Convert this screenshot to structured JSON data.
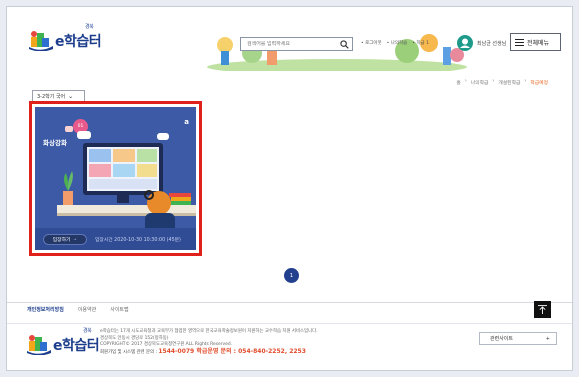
{
  "header": {
    "logo_text": "e학습터",
    "logo_small": "경북",
    "search_placeholder": "검색어를 입력하세요",
    "util_links": [
      "• 로그아웃",
      "• 나의학습",
      "• 학급 1"
    ],
    "user_name": "최남균 선생님",
    "menu_label": "전체메뉴"
  },
  "breadcrumb": [
    "홈",
    "›",
    "나의학급",
    "›",
    "개설된학급",
    "›",
    "학급예정"
  ],
  "filter": {
    "selected": "3-2학기 국어"
  },
  "card": {
    "title": "화상강화",
    "badge": "01",
    "corner_label": "a",
    "join_label": "입장하기",
    "join_arrow": "→",
    "join_time": "입장시간 2020-10-30 10:30:00 (45분)"
  },
  "pagination": {
    "current": "1"
  },
  "footer": {
    "links": [
      "개인정보처리방침",
      "이용약관",
      "사이트맵"
    ],
    "desc_lines": [
      "e학습터는 17개 시도교육청과 교육부가 협업한 영역으로 한국교육학술정보원이 지원하는 교수학습 지원 서비스입니다.",
      "경상북도 안동시 경당로 152(정하동)",
      "COPYRIGHT© 2017 경상북도교육청연구원 ALL Rights Reserved."
    ],
    "contact_prefix": "회원가입 및 시스템 관련 문의 :",
    "contact_phone": "1544-0079 학급운영 문의 : 054-840-2252, 2253",
    "related_label": "관련사이트",
    "related_icon": "+"
  },
  "colors": {
    "brand_blue": "#1c3d8c",
    "card_bg": "#3c5aa6",
    "highlight_red": "#e0201b",
    "accent_orange": "#e96d2a"
  }
}
